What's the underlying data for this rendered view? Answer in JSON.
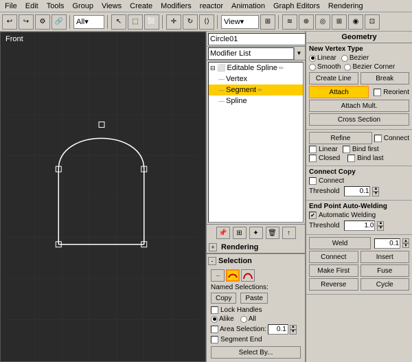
{
  "menubar": {
    "items": [
      "File",
      "Edit",
      "Tools",
      "Group",
      "Views",
      "Create",
      "Modifiers",
      "reactor",
      "Animation",
      "Graph Editors",
      "Rendering"
    ]
  },
  "toolbar": {
    "dropdown_value": "All",
    "view_dropdown": "View"
  },
  "viewport": {
    "label": "Front"
  },
  "modifier_panel": {
    "object_name": "Circle01",
    "modifier_list_label": "Modifier List",
    "tree_items": [
      {
        "label": "Editable Spline",
        "indent": 0,
        "has_expand": true,
        "selected": false,
        "has_pencil": true
      },
      {
        "label": "Vertex",
        "indent": 1,
        "selected": false
      },
      {
        "label": "Segment",
        "indent": 1,
        "selected": true,
        "has_pencil": true
      },
      {
        "label": "Spline",
        "indent": 1,
        "selected": false
      }
    ]
  },
  "rendering_section": {
    "label": "Rendering",
    "toggle": "+"
  },
  "selection_section": {
    "label": "Selection",
    "toggle": "-",
    "icons": [
      {
        "name": "vertex-icon",
        "symbol": "···",
        "tooltip": "Vertex"
      },
      {
        "name": "segment-icon",
        "symbol": "~",
        "active": true,
        "tooltip": "Segment"
      },
      {
        "name": "spline-icon",
        "symbol": "∿",
        "tooltip": "Spline"
      }
    ],
    "named_selections_label": "Named Selections:",
    "copy_label": "Copy",
    "paste_label": "Paste",
    "lock_handles_label": "Lock Handles",
    "alike_label": "Alike",
    "all_label": "All",
    "area_selection_label": "Area Selection:",
    "area_selection_value": "0.1",
    "segment_end_label": "Segment End",
    "select_by_label": "Select By..."
  },
  "geometry_panel": {
    "title": "Geometry",
    "new_vertex_type_label": "New Vertex Type",
    "linear_label": "Linear",
    "bezier_label": "Bezier",
    "smooth_label": "Smooth",
    "bezier_corner_label": "Bezier Corner",
    "create_line_label": "Create Line",
    "break_label": "Break",
    "attach_label": "Attach",
    "reorient_label": "Reorient",
    "attach_mult_label": "Attach Mult.",
    "cross_section_label": "Cross Section",
    "refine_label": "Refine",
    "connect_label_top": "Connect",
    "linear_label2": "Linear",
    "bind_first_label": "Bind first",
    "closed_label": "Closed",
    "bind_last_label": "Bind last",
    "connect_copy_label": "Connect Copy",
    "connect_label": "Connect",
    "threshold_label": "Threshold",
    "threshold_value": "0.1",
    "end_point_label": "End Point Auto-Welding",
    "automatic_welding_label": "Automatic Welding",
    "threshold2_label": "Threshold",
    "threshold2_value": "1.0",
    "weld_label": "Weld",
    "weld_value": "0.1",
    "connect_label2": "Connect",
    "insert_label": "Insert",
    "make_first_label": "Make First",
    "fuse_label": "Fuse",
    "reverse_label": "Reverse",
    "cycle_label": "Cycle"
  }
}
